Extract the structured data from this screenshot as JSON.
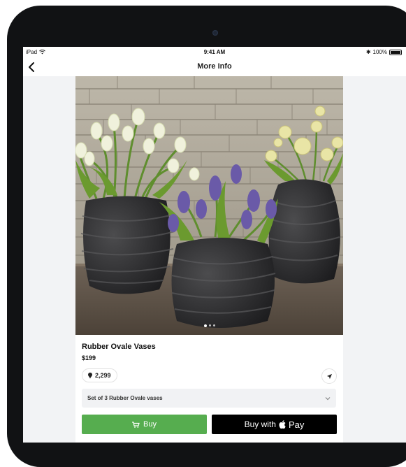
{
  "status_bar": {
    "carrier": "iPad",
    "wifi_icon": "wifi-icon",
    "time": "9:41 AM",
    "bluetooth_icon": "bluetooth-icon",
    "battery": "100%"
  },
  "nav": {
    "back_icon": "chevron-left-icon",
    "title": "More Info"
  },
  "product": {
    "image_dots": 3,
    "image_dots_active": 1,
    "title": "Rubber Ovale Vases",
    "price": "$199",
    "likes_icon": "pin-icon",
    "likes": "2,299",
    "share_icon": "location-arrow-icon",
    "option_selected": "Set of 3 Rubber Ovale vases",
    "option_chevron": "chevron-down-icon"
  },
  "buttons": {
    "buy_icon": "cart-icon",
    "buy_label": "Buy",
    "applepay_prefix": "Buy with",
    "applepay_brand": "Pay"
  },
  "colors": {
    "buy_green": "#56ad4f",
    "applepay_black": "#000000",
    "device_frame": "#111214"
  }
}
